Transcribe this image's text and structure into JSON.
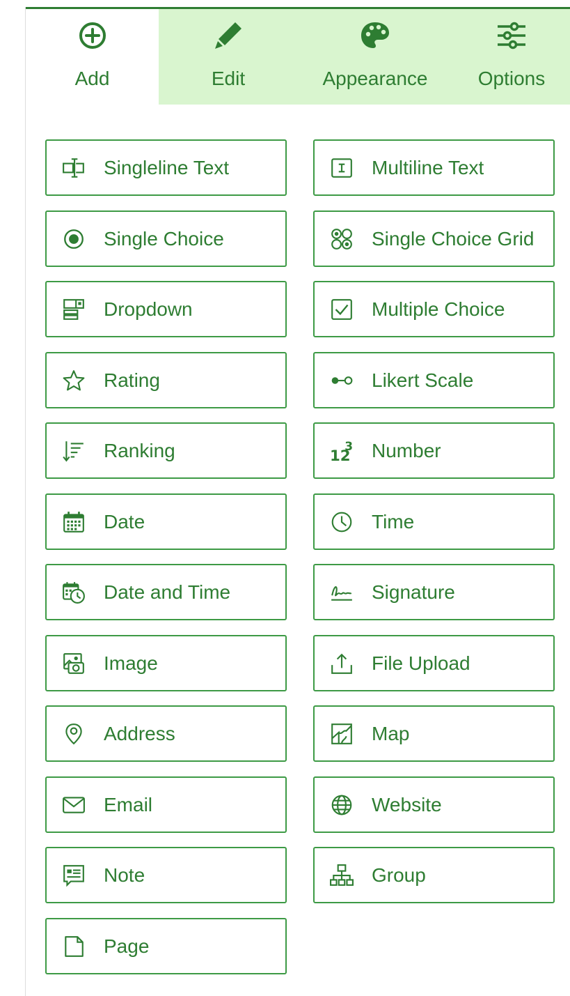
{
  "tabs": [
    {
      "id": "add",
      "label": "Add",
      "icon": "add-circle-icon",
      "active": true
    },
    {
      "id": "edit",
      "label": "Edit",
      "icon": "pencil-icon",
      "active": false
    },
    {
      "id": "appearance",
      "label": "Appearance",
      "icon": "palette-icon",
      "active": false
    },
    {
      "id": "options",
      "label": "Options",
      "icon": "sliders-icon",
      "active": false
    }
  ],
  "fields": [
    {
      "label": "Singleline Text",
      "icon": "singleline-text-icon"
    },
    {
      "label": "Multiline Text",
      "icon": "multiline-text-icon"
    },
    {
      "label": "Single Choice",
      "icon": "radio-icon"
    },
    {
      "label": "Single Choice Grid",
      "icon": "radio-grid-icon"
    },
    {
      "label": "Dropdown",
      "icon": "dropdown-icon"
    },
    {
      "label": "Multiple Choice",
      "icon": "checkbox-icon"
    },
    {
      "label": "Rating",
      "icon": "star-icon"
    },
    {
      "label": "Likert Scale",
      "icon": "likert-icon"
    },
    {
      "label": "Ranking",
      "icon": "ranking-icon"
    },
    {
      "label": "Number",
      "icon": "number-icon"
    },
    {
      "label": "Date",
      "icon": "calendar-icon"
    },
    {
      "label": "Time",
      "icon": "clock-icon"
    },
    {
      "label": "Date and Time",
      "icon": "calendar-clock-icon"
    },
    {
      "label": "Signature",
      "icon": "signature-icon"
    },
    {
      "label": "Image",
      "icon": "image-icon"
    },
    {
      "label": "File Upload",
      "icon": "upload-icon"
    },
    {
      "label": "Address",
      "icon": "location-pin-icon"
    },
    {
      "label": "Map",
      "icon": "map-icon"
    },
    {
      "label": "Email",
      "icon": "envelope-icon"
    },
    {
      "label": "Website",
      "icon": "globe-icon"
    },
    {
      "label": "Note",
      "icon": "note-icon"
    },
    {
      "label": "Group",
      "icon": "group-icon"
    },
    {
      "label": "Page",
      "icon": "page-icon"
    }
  ],
  "colors": {
    "accent": "#2e7d32",
    "border": "#3d9a45",
    "tab_background": "#d9f5cf"
  }
}
